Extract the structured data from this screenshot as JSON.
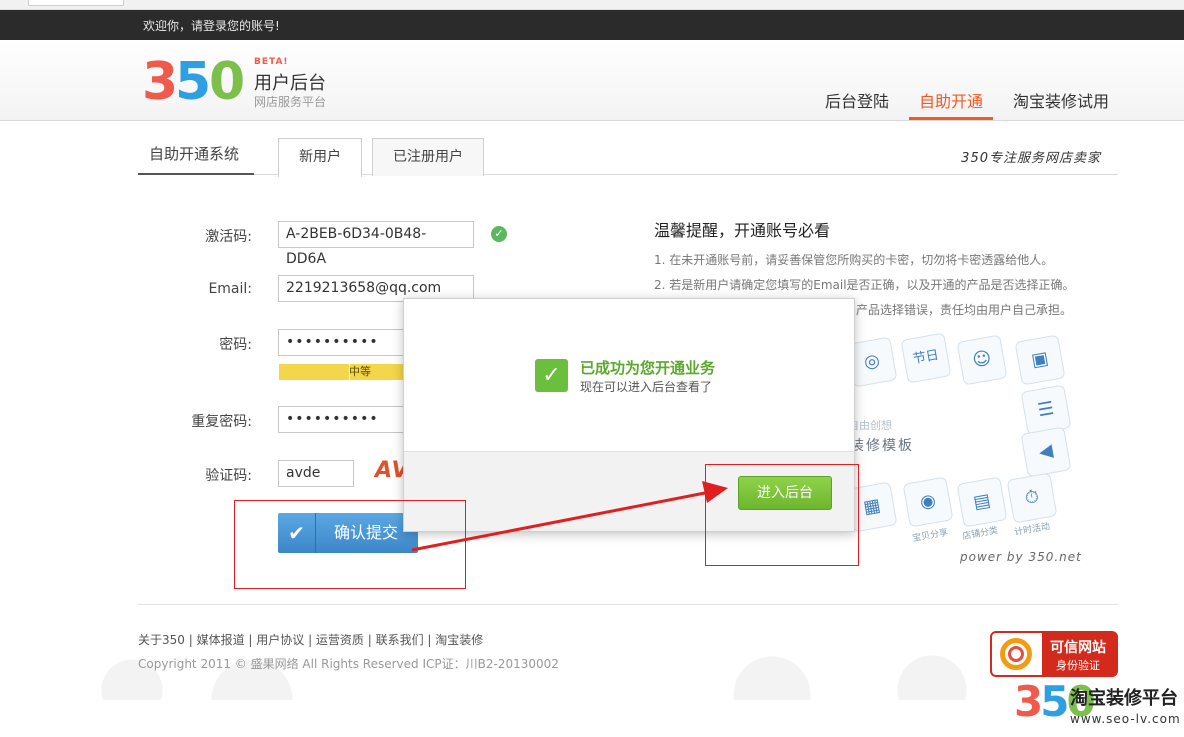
{
  "topbar": {
    "welcome": "欢迎你，请登录您的账号!"
  },
  "brand": {
    "beta": "BETA!",
    "logo_3": "3",
    "logo_5": "5",
    "logo_0": "0",
    "title": "用户后台",
    "subtitle": "网店服务平台"
  },
  "nav": [
    {
      "label": "后台登陆",
      "active": false
    },
    {
      "label": "自助开通",
      "active": true
    },
    {
      "label": "淘宝装修试用",
      "active": false
    }
  ],
  "tabs": {
    "system_title": "自助开通系统",
    "new_user": "新用户",
    "registered_user": "已注册用户",
    "slogan": "350专注服务网店卖家"
  },
  "form": {
    "activation_label": "激活码:",
    "activation_value": "A-2BEB-6D34-0B48-DD6A",
    "email_label": "Email:",
    "email_value": "2219213658@qq.com",
    "password_label": "密码:",
    "password_value": "••••••••••",
    "strength_label": "中等",
    "confirm_label": "重复密码:",
    "confirm_value": "••••••••••",
    "captcha_label": "验证码:",
    "captcha_value": "avde",
    "captcha_image_text": "AV",
    "submit_label": "确认提交"
  },
  "tips": {
    "title": "温馨提醒，开通账号必看",
    "line1": "1. 在未开通账号前，请妥善保管您所购买的卡密，切勿将卡密透露给他人。",
    "line2": "2. 若是新用户请确定您填写的Email是否正确，以及开通的产品是否选择正确。",
    "line3_partial": "产品选择错误，责任均由用户自己承担。"
  },
  "template_panel": {
    "caption1": "自由创想",
    "caption2": "装修模板",
    "power_by": "power by 350.net",
    "icon_labels": [
      "节日",
      "宝贝分享",
      "店铺分类",
      "计时活动"
    ]
  },
  "modal": {
    "success_title": "已成功为您开通业务",
    "success_sub": "现在可以进入后台查看了",
    "enter_label": "进入后台"
  },
  "footer": {
    "links": "关于350 | 媒体报道 | 用户协议 | 运营资质 | 联系我们 | 淘宝装修",
    "copyright": "Copyright 2011 © 盛果网络 All Rights Reserved ICP证：川B2-20130002"
  },
  "trust_badge": {
    "line1": "可信网站",
    "line2": "身份验证"
  },
  "watermark": {
    "logo_3": "3",
    "logo_5": "5",
    "logo_0": "0",
    "text": "淘宝装修平台",
    "url": "www.seo-lv.com"
  },
  "colors": {
    "accent": "#f15a24",
    "success": "#6cbf3c",
    "submit": "#3c86c9",
    "annotation": "#e02020"
  }
}
